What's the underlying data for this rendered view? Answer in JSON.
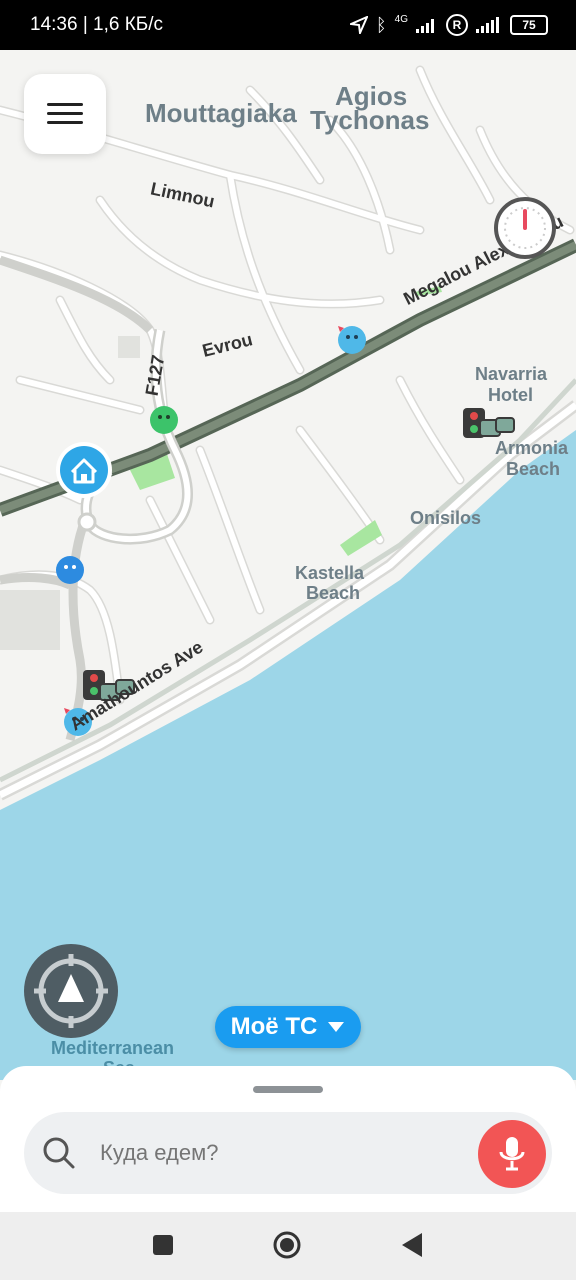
{
  "status_bar": {
    "time_and_speed": "14:36 | 1,6 КБ/с",
    "network": "4G",
    "roaming": "R",
    "battery": "75"
  },
  "map": {
    "labels": {
      "moutt": "Mouttagiaka",
      "agios": "Agios",
      "tychonas": "Tychonas",
      "limnou": "Limnou",
      "evrou": "Evrou",
      "f127": "F127",
      "megalou": "Megalou Alexandrou",
      "navarria1": "Navarria",
      "navarria2": "Hotel",
      "armonia1": "Armonia",
      "armonia2": "Beach",
      "onisilos": "Onisilos",
      "kastella1": "Kastella",
      "kastella2": "Beach",
      "amathountos": "Amathountos Ave",
      "med1": "Mediterranean",
      "med2": "Sea"
    },
    "colors": {
      "land": "#f4f4f2",
      "water": "#9dd6e8",
      "road": "#ffffff",
      "road_outline": "#d9d9d6",
      "highway": "#6d7d6b",
      "park": "#a8e6a0",
      "label": "#6e7f88"
    }
  },
  "controls": {
    "menu_icon": "hamburger-icon",
    "speedometer_icon": "speedometer-icon",
    "recenter_icon": "navigation-arrow-icon",
    "vehicle_label": "Моё ТС",
    "vehicle_icon": "chevron-down-icon"
  },
  "search": {
    "placeholder": "Куда едем?",
    "search_icon": "search-icon",
    "mic_icon": "microphone-icon",
    "accent": "#f25555"
  },
  "nav_bar": {
    "recent_icon": "square-icon",
    "home_icon": "circle-icon",
    "back_icon": "triangle-back-icon"
  }
}
